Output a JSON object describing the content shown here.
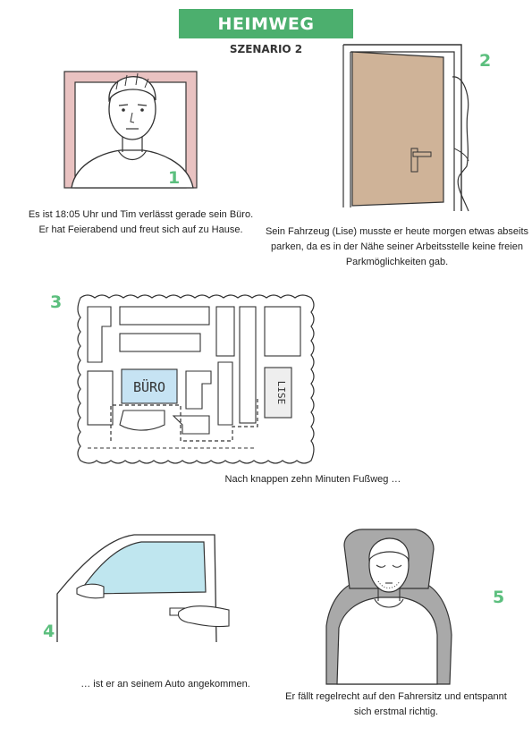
{
  "header": {
    "title": "HEIMWEG",
    "subtitle": "SZENARIO 2"
  },
  "colors": {
    "accent_green": "#4caf6e",
    "number_green": "#5cbf7e",
    "chair_pink": "#e9c2c1",
    "door_brown": "#cfb398",
    "office_blue": "#c6e3f3",
    "window_blue": "#bfe6ef",
    "seat_gray": "#a9a9a9"
  },
  "panels": [
    {
      "number": "1",
      "caption": "Es ist 18:05 Uhr und Tim verlässt gerade sein Büro. Er hat Feierabend und freut sich auf zu Hause.",
      "icon": "man-at-desk-illustration"
    },
    {
      "number": "2",
      "caption": "Sein Fahrzeug (Lise) musste er heute morgen etwas abseits parken, da es in der Nähe seiner Arbeitsstelle keine freien Parkmöglichkeiten gab.",
      "icon": "door-illustration"
    },
    {
      "number": "3",
      "caption": "Nach knappen zehn Minuten Fußweg …",
      "icon": "map-illustration",
      "map_labels": {
        "office": "BÜRO",
        "car": "LISE"
      }
    },
    {
      "number": "4",
      "caption": "… ist er an seinem Auto angekommen.",
      "icon": "car-door-illustration"
    },
    {
      "number": "5",
      "caption": "Er fällt regelrecht auf den Fahrersitz und entspannt sich erstmal richtig.",
      "icon": "man-in-seat-illustration"
    }
  ]
}
